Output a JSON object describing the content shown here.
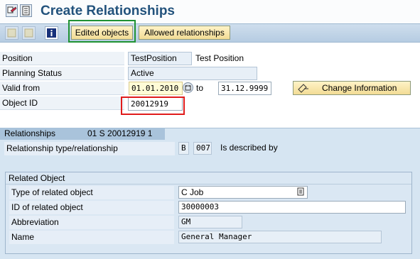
{
  "title": "Create Relationships",
  "title_icons": [
    "display-change-icon",
    "document-icon"
  ],
  "toolbar": {
    "icons": [
      "previous-object-icon",
      "next-object-icon",
      "info-icon"
    ],
    "edited_objects": "Edited objects",
    "allowed_relationships": "Allowed relationships"
  },
  "form": {
    "position_label": "Position",
    "position_value": "TestPosition",
    "position_text": "Test Position",
    "planning_status_label": "Planning Status",
    "planning_status_value": "Active",
    "valid_from_label": "Valid from",
    "valid_from_value": "01.01.2010",
    "to_label": "to",
    "valid_to_value": "31.12.9999",
    "change_information": "Change Information",
    "object_id_label": "Object ID",
    "object_id_value": "20012919"
  },
  "relationships": {
    "header_label": "Relationships",
    "header_info": "01 S  20012919 1",
    "type_label": "Relationship type/relationship",
    "type_code": "B",
    "rel_code": "007",
    "rel_text": "Is described by",
    "related_object": {
      "header": "Related Object",
      "type_label": "Type of related object",
      "type_value": "C Job",
      "id_label": "ID of related object",
      "id_value": "30000003",
      "abbr_label": "Abbreviation",
      "abbr_value": "GM",
      "name_label": "Name",
      "name_value": "General Manager"
    }
  },
  "colors": {
    "title": "#22527c",
    "highlight_green": "#1f9233",
    "highlight_red": "#e01b1b",
    "button_fill": "#f2dc95"
  }
}
